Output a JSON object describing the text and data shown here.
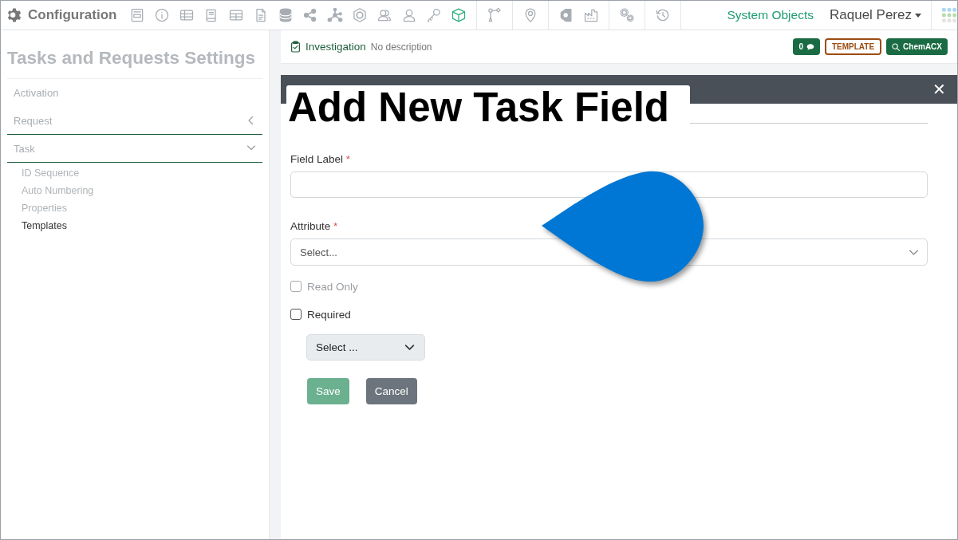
{
  "app": {
    "title": "Configuration"
  },
  "toolbar_groups": [
    [
      {
        "kind": "form",
        "selected": false
      },
      {
        "kind": "info",
        "selected": false
      },
      {
        "kind": "table",
        "selected": false
      },
      {
        "kind": "book",
        "selected": false
      },
      {
        "kind": "grid",
        "selected": false
      },
      {
        "kind": "document",
        "selected": false
      },
      {
        "kind": "database",
        "selected": false
      },
      {
        "kind": "share",
        "selected": false
      },
      {
        "kind": "hub",
        "selected": false
      },
      {
        "kind": "hexagon",
        "selected": false
      },
      {
        "kind": "users",
        "selected": false
      },
      {
        "kind": "user",
        "selected": false
      },
      {
        "kind": "key",
        "selected": false
      },
      {
        "kind": "cube",
        "selected": true
      }
    ],
    [
      {
        "kind": "branch",
        "selected": false
      }
    ],
    [
      {
        "kind": "pin",
        "selected": false
      }
    ],
    [
      {
        "kind": "tag",
        "selected": false
      },
      {
        "kind": "factory",
        "selected": false
      }
    ],
    [
      {
        "kind": "gears",
        "selected": false
      }
    ],
    [
      {
        "kind": "history",
        "selected": false
      }
    ]
  ],
  "top_right": {
    "link": "System Objects",
    "user": "Raquel Perez"
  },
  "sidebar": {
    "title": "Tasks and Requests Settings",
    "items": [
      {
        "kind": "link",
        "label": "Activation"
      },
      {
        "kind": "section",
        "label": "Request",
        "expanded": false
      },
      {
        "kind": "section",
        "label": "Task",
        "expanded": true,
        "children": [
          {
            "label": "ID Sequence",
            "selected": false
          },
          {
            "label": "Auto Numbering",
            "selected": false
          },
          {
            "label": "Properties",
            "selected": false
          },
          {
            "label": "Templates",
            "selected": true
          }
        ]
      }
    ]
  },
  "record": {
    "title": "Investigation",
    "description": "No description",
    "comments": "0",
    "badge": "TEMPLATE",
    "search_button": "ChemACX"
  },
  "modal": {
    "close": "✕",
    "annotation": "Add New Task Field",
    "fields": [
      {
        "kind": "text",
        "label": "Field Label",
        "required_mark": "*"
      },
      {
        "kind": "select",
        "label": "Attribute",
        "required_mark": "*",
        "placeholder": "Select..."
      },
      {
        "kind": "checkbox",
        "label": "Read Only",
        "checked": false,
        "disabled": true
      },
      {
        "kind": "checkbox",
        "label": "Required",
        "checked": false,
        "disabled": false
      },
      {
        "kind": "dropdown",
        "label": "Select ..."
      }
    ],
    "buttons": [
      {
        "kind": "primary",
        "label": "Save",
        "disabled": true
      },
      {
        "kind": "secondary",
        "label": "Cancel",
        "disabled": false
      }
    ]
  }
}
